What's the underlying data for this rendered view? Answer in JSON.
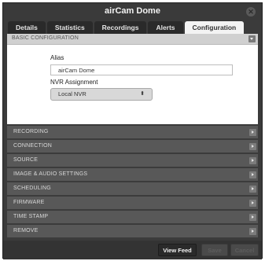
{
  "window": {
    "title": "airCam Dome"
  },
  "tabs": [
    {
      "label": "Details"
    },
    {
      "label": "Statistics"
    },
    {
      "label": "Recordings"
    },
    {
      "label": "Alerts"
    },
    {
      "label": "Configuration"
    }
  ],
  "basic_config": {
    "header": "BASIC CONFIGURATION",
    "alias_label": "Alias",
    "alias_value": "airCam Dome",
    "nvr_label": "NVR Assignment",
    "nvr_selected": "Local NVR"
  },
  "sections": [
    {
      "label": "RECORDING"
    },
    {
      "label": "CONNECTION"
    },
    {
      "label": "SOURCE"
    },
    {
      "label": "IMAGE & AUDIO SETTINGS"
    },
    {
      "label": "SCHEDULING"
    },
    {
      "label": "FIRMWARE"
    },
    {
      "label": "TIME STAMP"
    },
    {
      "label": "REMOVE"
    }
  ],
  "footer": {
    "view_feed": "View Feed",
    "save": "Save",
    "cancel": "Cancel"
  },
  "icons": {
    "close": "close-icon",
    "collapse": "chevron-down-icon",
    "expand": "chevron-right-icon",
    "select": "up-down-arrows-icon"
  },
  "colors": {
    "window_bg": "#3b3b3b",
    "active_tab": "#f3f3f3",
    "section_bar": "#585858"
  }
}
